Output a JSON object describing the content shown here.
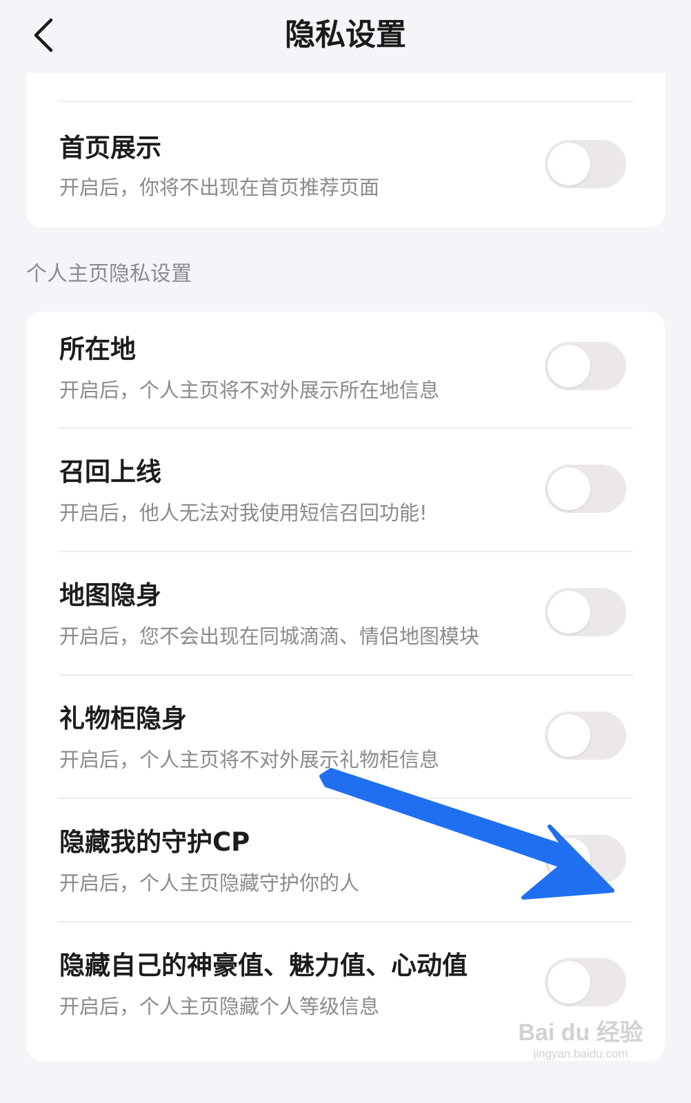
{
  "header": {
    "title": "隐私设置",
    "back_icon": "chevron-left-icon"
  },
  "top_card": {
    "items": [
      {
        "title": "首页展示",
        "desc": "开启后，你将不出现在首页推荐页面",
        "enabled": false
      }
    ]
  },
  "section": {
    "label": "个人主页隐私设置"
  },
  "main_card": {
    "items": [
      {
        "title": "所在地",
        "desc": "开启后，个人主页将不对外展示所在地信息",
        "enabled": false
      },
      {
        "title": "召回上线",
        "desc": "开启后，他人无法对我使用短信召回功能!",
        "enabled": false
      },
      {
        "title": "地图隐身",
        "desc": "开启后，您不会出现在同城滴滴、情侣地图模块",
        "enabled": false
      },
      {
        "title": "礼物柜隐身",
        "desc": "开启后，个人主页将不对外展示礼物柜信息",
        "enabled": false
      },
      {
        "title": "隐藏我的守护CP",
        "desc": "开启后，个人主页隐藏守护你的人",
        "enabled": false
      },
      {
        "title": "隐藏自己的神豪值、魅力值、心动值",
        "desc": "开启后，个人主页隐藏个人等级信息",
        "enabled": false
      }
    ]
  },
  "annotation": {
    "arrow_color": "#1f6ff0"
  },
  "watermark": {
    "logo": "Bai du 经验",
    "url": "jingyan.baidu.com"
  },
  "colors": {
    "background": "#f4f4f9",
    "card": "#ffffff",
    "toggle_off": "#ece8ea"
  }
}
